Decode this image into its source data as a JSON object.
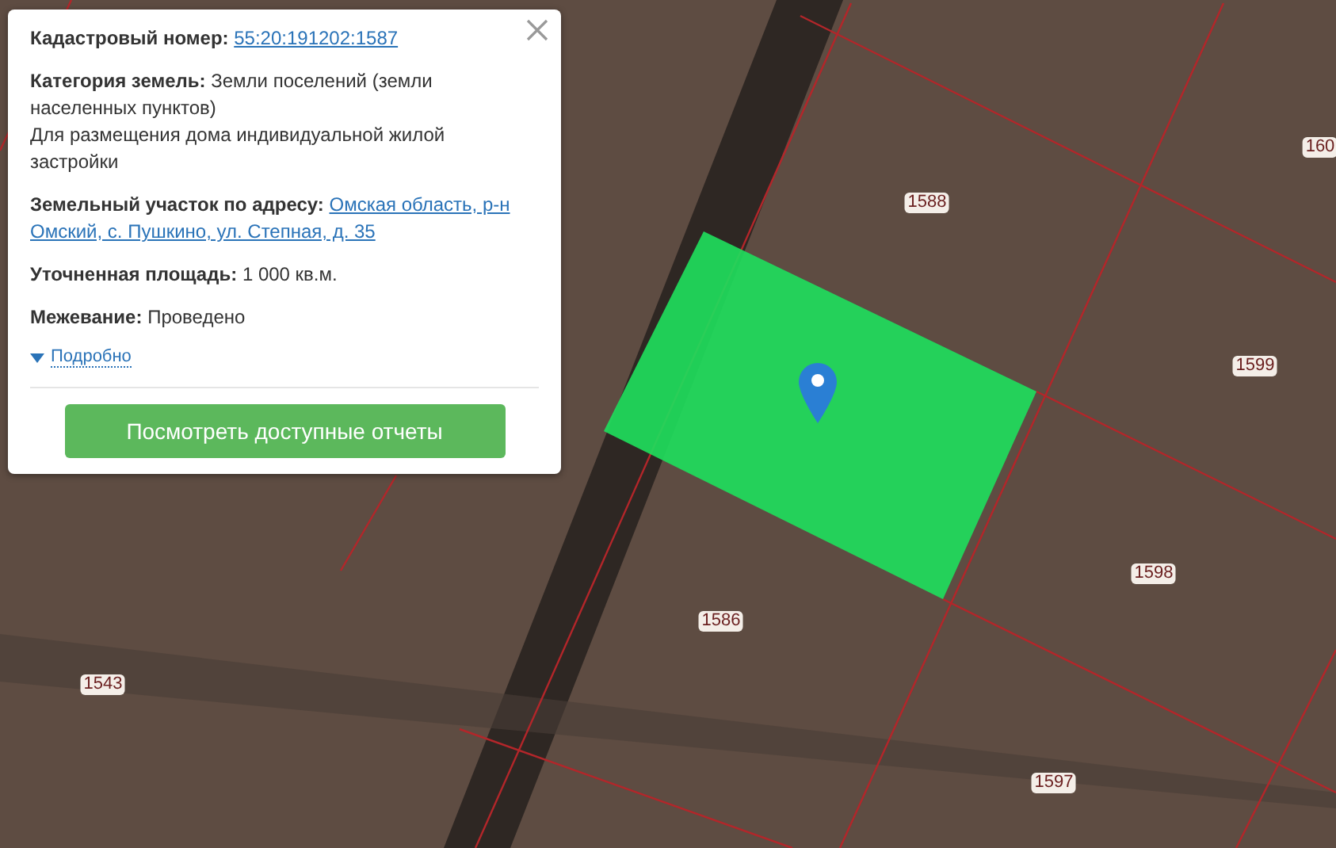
{
  "popup": {
    "fields": [
      {
        "label": "Кадастровый номер:",
        "value": "55:20:191202:1587",
        "link": true
      },
      {
        "label": "Категория земель:",
        "value": "Земли поселений (земли населенных пунктов)",
        "link": false,
        "lines": [
          "Для размещения дома индивидуальной жилой застройки"
        ]
      },
      {
        "label": "Земельный участок по адресу:",
        "value": "Омская область, р-н",
        "link": true,
        "lines": [
          "Омский, с. Пушкино, ул. Степная, д. 35"
        ]
      },
      {
        "label": "Уточненная площадь:",
        "value": "1 000 кв.м.",
        "link": false
      },
      {
        "label": "Межевание:",
        "value": "Проведено",
        "link": false
      }
    ],
    "details_link": "Подробно",
    "button": "Посмотреть доступные отчеты"
  },
  "map": {
    "parcel_labels": [
      "1588",
      "160",
      "1599",
      "1598",
      "1586",
      "1543",
      "1597"
    ]
  }
}
